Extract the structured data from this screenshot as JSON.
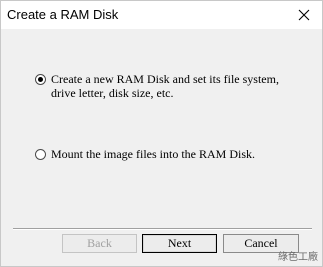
{
  "window": {
    "title": "Create a RAM Disk"
  },
  "options": [
    {
      "label": "Create a new RAM Disk and set its file system, drive letter, disk size, etc.",
      "checked": true
    },
    {
      "label": "Mount the image files into the RAM Disk.",
      "checked": false
    }
  ],
  "buttons": {
    "back": "Back",
    "next": "Next",
    "cancel": "Cancel"
  },
  "watermark": "綠色工廠",
  "icons": {
    "close": "close-icon"
  }
}
